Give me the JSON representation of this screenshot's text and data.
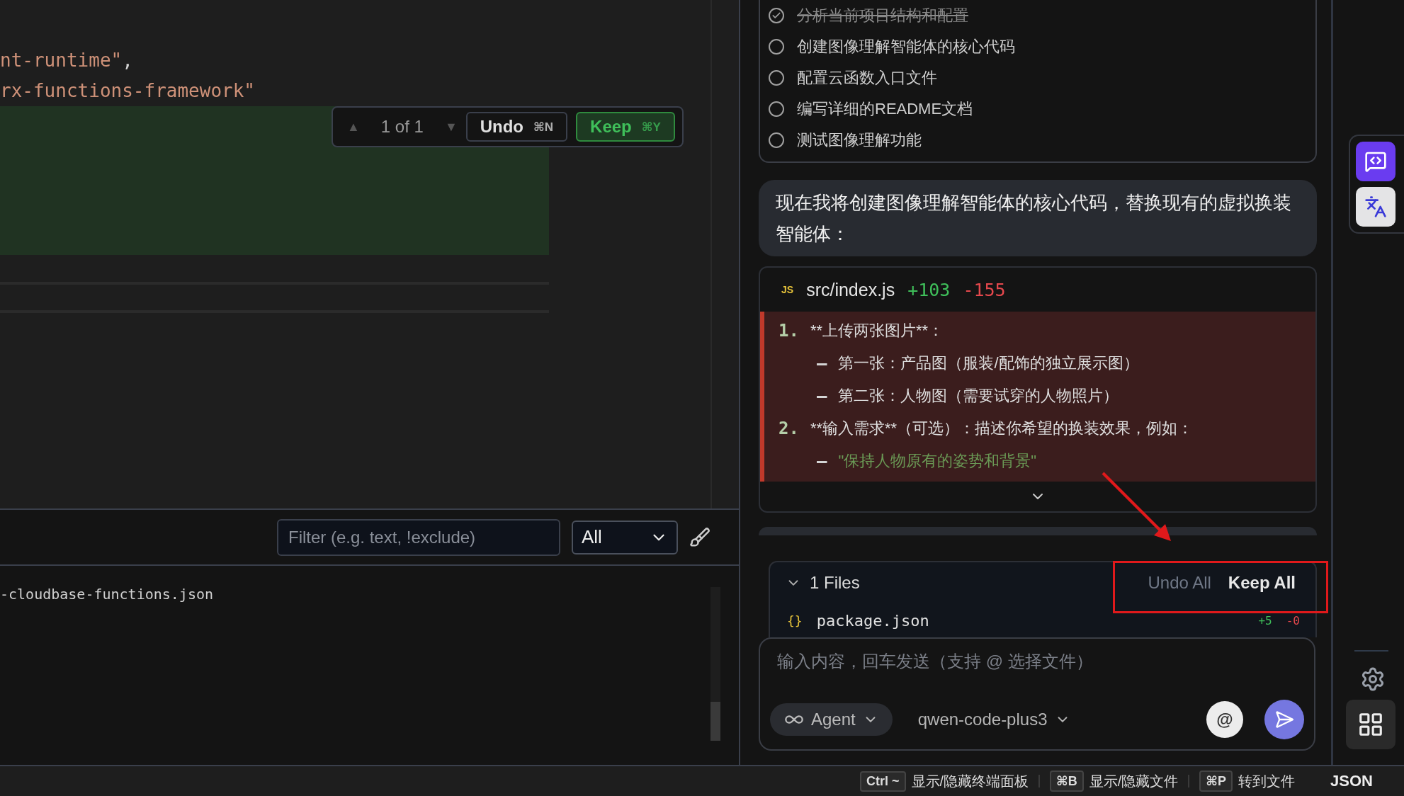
{
  "editor": {
    "code_lines": [
      {
        "text": "nt-runtime\"",
        "trailing": ","
      },
      {
        "text": "rx-functions-framework\""
      }
    ],
    "diff_toolbar": {
      "previous": "▲",
      "counter": "1 of 1",
      "next": "▼",
      "undo": {
        "label": "Undo",
        "shortcut": "⌘N"
      },
      "keep": {
        "label": "Keep",
        "shortcut": "⌘Y"
      }
    }
  },
  "output_panel": {
    "filter_placeholder": "Filter (e.g. text, !exclude)",
    "level_select": "All",
    "lines": [
      "-cloudbase-functions.json"
    ]
  },
  "chat": {
    "todos": [
      {
        "text": "分析当前项目结构和配置",
        "checked": true
      },
      {
        "text": "创建图像理解智能体的核心代码",
        "checked": false
      },
      {
        "text": "配置云函数入口文件",
        "checked": false
      },
      {
        "text": "编写详细的README文档",
        "checked": false
      },
      {
        "text": "测试图像理解功能",
        "checked": false
      }
    ],
    "message": "现在我将创建图像理解智能体的核心代码，替换现有的虚拟换装智能体：",
    "diff_card": {
      "badge": "JS",
      "path": "src/index.js",
      "added": "+103",
      "removed": "-155",
      "lines": [
        {
          "kind": "item",
          "marker": "1.",
          "text": "**上传两张图片**："
        },
        {
          "kind": "bullet",
          "marker": "–",
          "text": "第一张：产品图（服装/配饰的独立展示图）"
        },
        {
          "kind": "bullet",
          "marker": "–",
          "text": "第二张：人物图（需要试穿的人物照片）"
        },
        {
          "kind": "item",
          "marker": "2.",
          "text": "**输入需求**（可选）：描述你希望的换装效果，例如："
        },
        {
          "kind": "string",
          "marker": "–",
          "text": "\"保持人物原有的姿势和背景\""
        }
      ]
    },
    "files_panel": {
      "count_label": "1 Files",
      "expanded": true,
      "undo_all": "Undo All",
      "keep_all": "Keep All",
      "files": [
        {
          "icon": "{}",
          "name": "package.json",
          "added": "+5",
          "removed": "-0"
        }
      ]
    },
    "composer": {
      "placeholder": "输入内容，回车发送（支持 @ 选择文件）",
      "mode": "Agent",
      "model": "qwen-code-plus3",
      "mention": "@"
    }
  },
  "status_bar": {
    "shortcuts": [
      {
        "key": "Ctrl ~",
        "label": "显示/隐藏终端面板"
      },
      {
        "key": "⌘B",
        "label": "显示/隐藏文件"
      },
      {
        "key": "⌘P",
        "label": "转到文件"
      }
    ],
    "language": "JSON"
  }
}
